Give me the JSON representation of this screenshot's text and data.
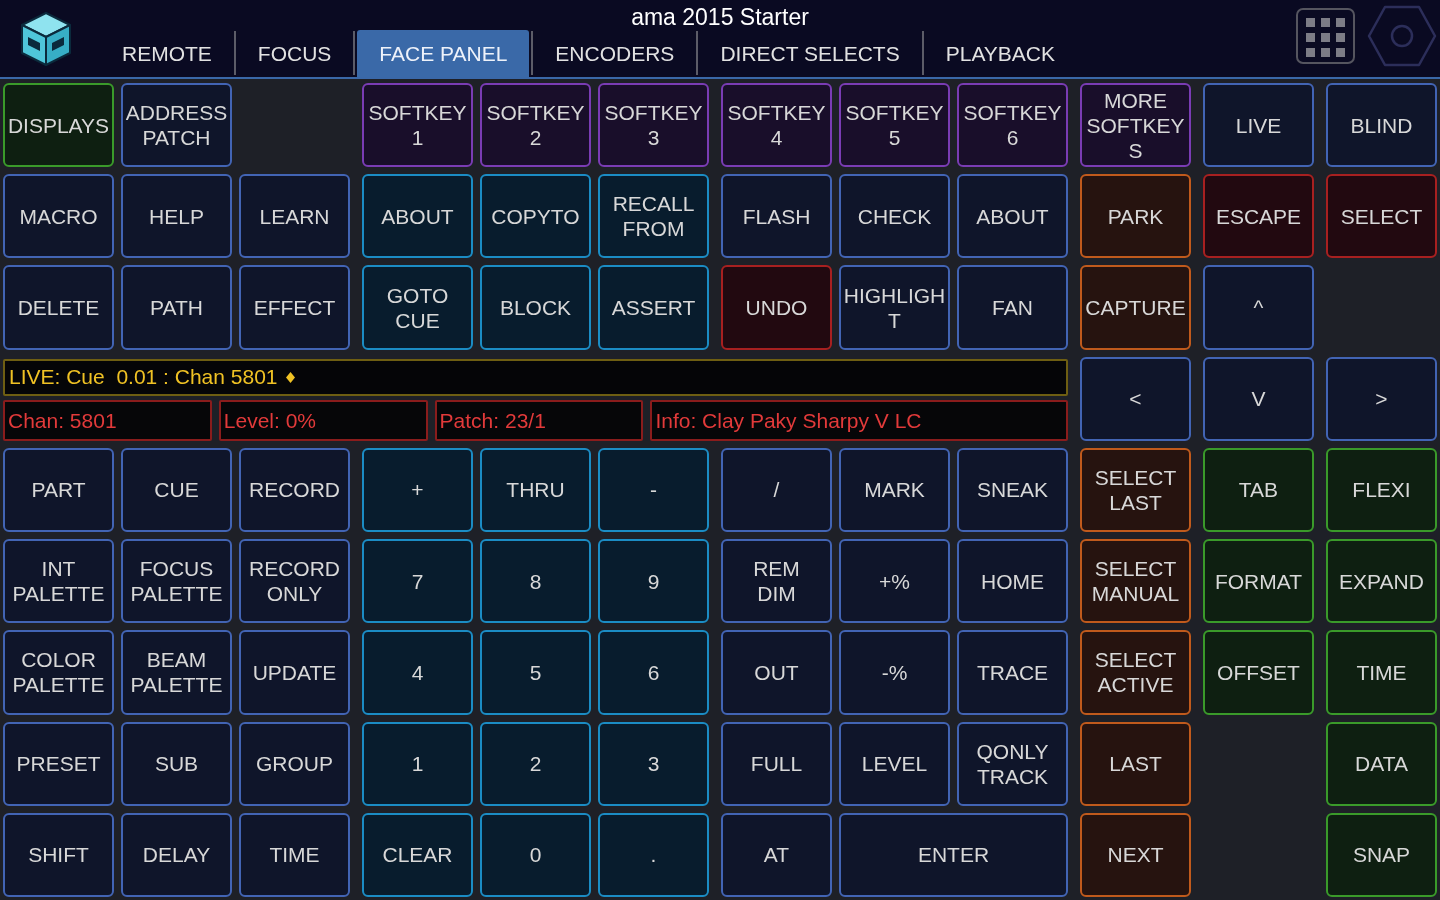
{
  "title": "ama 2015 Starter",
  "tabs": [
    {
      "label": "REMOTE",
      "selected": false
    },
    {
      "label": "FOCUS",
      "selected": false
    },
    {
      "label": "FACE PANEL",
      "selected": true
    },
    {
      "label": "ENCODERS",
      "selected": false
    },
    {
      "label": "DIRECT SELECTS",
      "selected": false
    },
    {
      "label": "PLAYBACK",
      "selected": false
    }
  ],
  "upper_keys": [
    [
      {
        "label": "DISPLAYS",
        "color": "#3a9a2a"
      },
      {
        "label": "ADDRESS PATCH",
        "color": "#4264b4"
      },
      {
        "label": "SOFTKEY 1",
        "color": "#7a3cb4"
      },
      {
        "label": "SOFTKEY 2",
        "color": "#7a3cb4"
      },
      {
        "label": "SOFTKEY 3",
        "color": "#7a3cb4"
      },
      {
        "label": "SOFTKEY 4",
        "color": "#7a3cb4"
      },
      {
        "label": "SOFTKEY 5",
        "color": "#7a3cb4"
      },
      {
        "label": "SOFTKEY 6",
        "color": "#7a3cb4"
      },
      {
        "label": "MORE SOFTKEYS",
        "color": "#7a3cb4"
      },
      {
        "label": "LIVE",
        "color": "#4264b4"
      },
      {
        "label": "BLIND",
        "color": "#4264b4"
      }
    ],
    [
      {
        "label": "MACRO",
        "color": "#4264b4"
      },
      {
        "label": "HELP",
        "color": "#4264b4"
      },
      {
        "label": "LEARN",
        "color": "#4264b4"
      },
      {
        "label": "ABOUT",
        "color": "#1b8cc4"
      },
      {
        "label": "COPYTO",
        "color": "#1b8cc4"
      },
      {
        "label": "RECALL FROM",
        "color": "#1b8cc4"
      },
      {
        "label": "FLASH",
        "color": "#4264b4"
      },
      {
        "label": "CHECK",
        "color": "#4264b4"
      },
      {
        "label": "ABOUT",
        "color": "#4264b4"
      },
      {
        "label": "PARK",
        "color": "#c05a1c"
      },
      {
        "label": "ESCAPE",
        "color": "#a82020"
      },
      {
        "label": "SELECT",
        "color": "#a82020"
      }
    ],
    [
      {
        "label": "DELETE",
        "color": "#4264b4"
      },
      {
        "label": "PATH",
        "color": "#4264b4"
      },
      {
        "label": "EFFECT",
        "color": "#4264b4"
      },
      {
        "label": "GOTO CUE",
        "color": "#1b8cc4"
      },
      {
        "label": "BLOCK",
        "color": "#1b8cc4"
      },
      {
        "label": "ASSERT",
        "color": "#1b8cc4"
      },
      {
        "label": "UNDO",
        "color": "#a82020"
      },
      {
        "label": "HIGHLIGHT",
        "color": "#4264b4"
      },
      {
        "label": "FAN",
        "color": "#4264b4"
      },
      {
        "label": "CAPTURE",
        "color": "#c05a1c"
      },
      {
        "label": "^",
        "color": "#4264b4"
      }
    ]
  ],
  "status": {
    "command_line": "LIVE: Cue  0.01 : Chan 5801",
    "fields": [
      "Chan: 5801",
      "Level: 0%",
      "Patch: 23/1",
      "Info: Clay Paky Sharpy V LC"
    ]
  },
  "lower_keys": [
    [
      {
        "label": "<",
        "color": "#4264b4"
      },
      {
        "label": "V",
        "color": "#4264b4"
      },
      {
        "label": ">",
        "color": "#4264b4"
      }
    ],
    [
      {
        "label": "PART",
        "color": "#4264b4"
      },
      {
        "label": "CUE",
        "color": "#4264b4"
      },
      {
        "label": "RECORD",
        "color": "#4264b4"
      },
      {
        "label": "+",
        "color": "#1b8cc4"
      },
      {
        "label": "THRU",
        "color": "#1b8cc4"
      },
      {
        "label": "-",
        "color": "#1b8cc4"
      },
      {
        "label": "/",
        "color": "#4264b4"
      },
      {
        "label": "MARK",
        "color": "#4264b4"
      },
      {
        "label": "SNEAK",
        "color": "#4264b4"
      },
      {
        "label": "SELECT LAST",
        "color": "#c05a1c"
      },
      {
        "label": "TAB",
        "color": "#3a9a2a"
      },
      {
        "label": "FLEXI",
        "color": "#3a9a2a"
      }
    ],
    [
      {
        "label": "INT PALETTE",
        "color": "#4264b4"
      },
      {
        "label": "FOCUS PALETTE",
        "color": "#4264b4"
      },
      {
        "label": "RECORD ONLY",
        "color": "#4264b4"
      },
      {
        "label": "7",
        "color": "#1b8cc4"
      },
      {
        "label": "8",
        "color": "#1b8cc4"
      },
      {
        "label": "9",
        "color": "#1b8cc4"
      },
      {
        "label": "REM DIM",
        "color": "#4264b4"
      },
      {
        "label": "+%",
        "color": "#4264b4"
      },
      {
        "label": "HOME",
        "color": "#4264b4"
      },
      {
        "label": "SELECT MANUAL",
        "color": "#c05a1c"
      },
      {
        "label": "FORMAT",
        "color": "#3a9a2a"
      },
      {
        "label": "EXPAND",
        "color": "#3a9a2a"
      }
    ],
    [
      {
        "label": "COLOR PALETTE",
        "color": "#4264b4"
      },
      {
        "label": "BEAM PALETTE",
        "color": "#4264b4"
      },
      {
        "label": "UPDATE",
        "color": "#4264b4"
      },
      {
        "label": "4",
        "color": "#1b8cc4"
      },
      {
        "label": "5",
        "color": "#1b8cc4"
      },
      {
        "label": "6",
        "color": "#1b8cc4"
      },
      {
        "label": "OUT",
        "color": "#4264b4"
      },
      {
        "label": "-%",
        "color": "#4264b4"
      },
      {
        "label": "TRACE",
        "color": "#4264b4"
      },
      {
        "label": "SELECT ACTIVE",
        "color": "#c05a1c"
      },
      {
        "label": "OFFSET",
        "color": "#3a9a2a"
      },
      {
        "label": "TIME",
        "color": "#3a9a2a"
      }
    ],
    [
      {
        "label": "PRESET",
        "color": "#4264b4"
      },
      {
        "label": "SUB",
        "color": "#4264b4"
      },
      {
        "label": "GROUP",
        "color": "#4264b4"
      },
      {
        "label": "1",
        "color": "#1b8cc4"
      },
      {
        "label": "2",
        "color": "#1b8cc4"
      },
      {
        "label": "3",
        "color": "#1b8cc4"
      },
      {
        "label": "FULL",
        "color": "#4264b4"
      },
      {
        "label": "LEVEL",
        "color": "#4264b4"
      },
      {
        "label": "QONLY TRACK",
        "color": "#4264b4"
      },
      {
        "label": "LAST",
        "color": "#c05a1c"
      },
      {
        "label": "DATA",
        "color": "#3a9a2a"
      }
    ],
    [
      {
        "label": "SHIFT",
        "color": "#4264b4"
      },
      {
        "label": "DELAY",
        "color": "#4264b4"
      },
      {
        "label": "TIME",
        "color": "#4264b4"
      },
      {
        "label": "CLEAR",
        "color": "#1b8cc4"
      },
      {
        "label": "0",
        "color": "#1b8cc4"
      },
      {
        "label": ".",
        "color": "#1b8cc4"
      },
      {
        "label": "AT",
        "color": "#4264b4"
      },
      {
        "label": "ENTER",
        "color": "#4264b4"
      },
      {
        "label": "NEXT",
        "color": "#c05a1c"
      },
      {
        "label": "SNAP",
        "color": "#3a9a2a"
      }
    ]
  ]
}
